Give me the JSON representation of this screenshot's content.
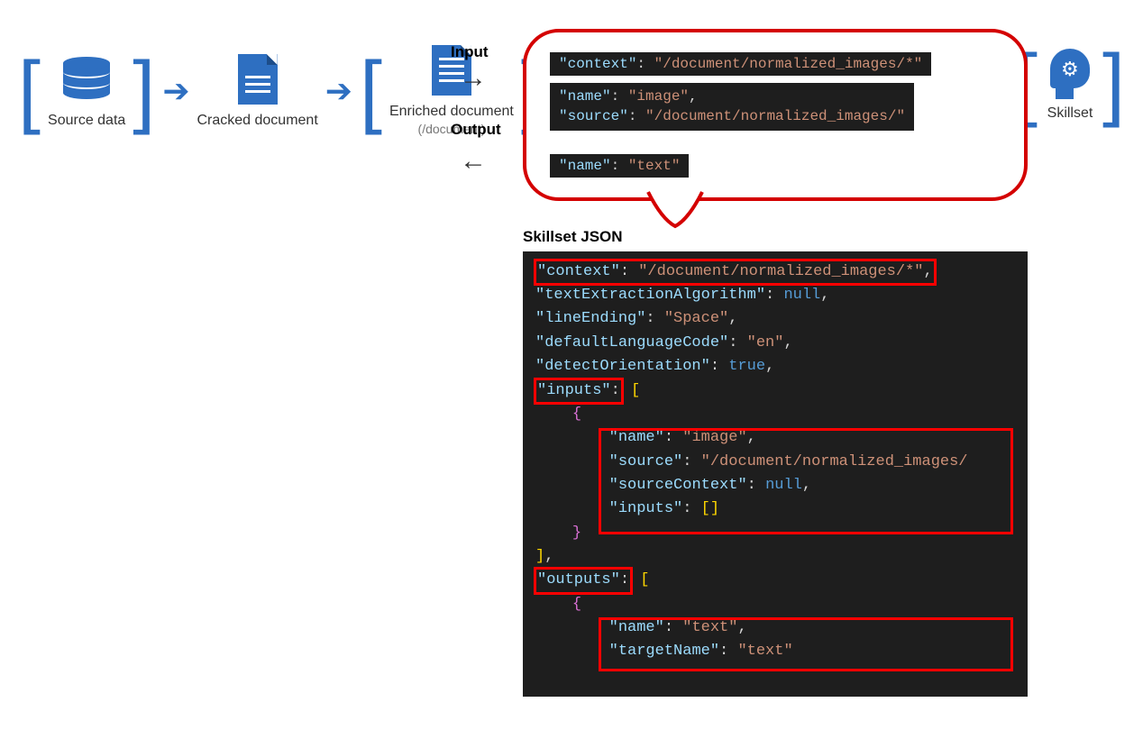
{
  "flow": {
    "source": {
      "label": "Source data"
    },
    "cracked": {
      "label": "Cracked document"
    },
    "enriched": {
      "label": "Enriched document",
      "sub": "(/document)"
    },
    "skillset": {
      "label": "Skillset"
    }
  },
  "io": {
    "input_label": "Input",
    "output_label": "Output"
  },
  "callout": {
    "line1_key": "\"context\"",
    "line1_val": "\"/document/normalized_images/*\"",
    "line2_key1": "\"name\"",
    "line2_val1": "\"image\"",
    "line2_key2": "\"source\"",
    "line2_val2": "\"/document/normalized_images/\"",
    "line3_key": "\"name\"",
    "line3_val": "\"text\""
  },
  "json_title": "Skillset JSON",
  "code": {
    "l1_key": "\"context\"",
    "l1_val": "\"/document/normalized_images/*\"",
    "l2_key": "\"textExtractionAlgorithm\"",
    "l2_val": "null",
    "l3_key": "\"lineEnding\"",
    "l3_val": "\"Space\"",
    "l4_key": "\"defaultLanguageCode\"",
    "l4_val": "\"en\"",
    "l5_key": "\"detectOrientation\"",
    "l5_val": "true",
    "l6_key": "\"inputs\"",
    "l7_key": "\"name\"",
    "l7_val": "\"image\"",
    "l8_key": "\"source\"",
    "l8_val": "\"/document/normalized_images/",
    "l9_key": "\"sourceContext\"",
    "l9_val": "null",
    "l10_key": "\"inputs\"",
    "l11_key": "\"outputs\"",
    "l12_key": "\"name\"",
    "l12_val": "\"text\"",
    "l13_key": "\"targetName\"",
    "l13_val": "\"text\""
  }
}
